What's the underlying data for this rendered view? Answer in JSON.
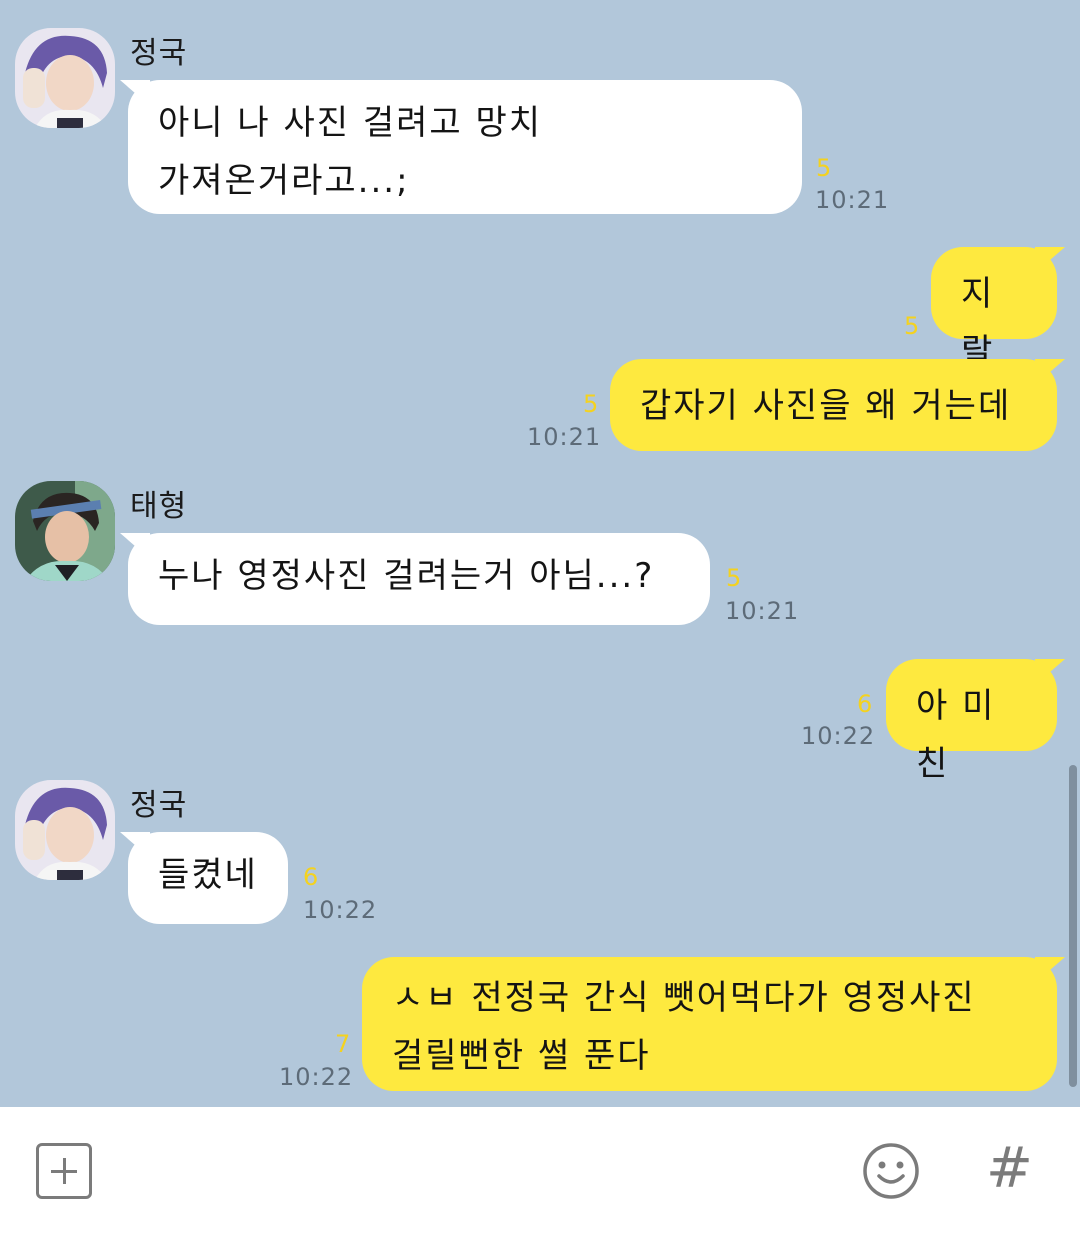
{
  "messages": [
    {
      "sender": "정국",
      "lines": [
        "아니 나 사진 걸려고 망치",
        "가져온거라고...;"
      ],
      "unread": "5",
      "time": "10:21",
      "direction": "in"
    },
    {
      "text": "지랄",
      "unread": "5",
      "direction": "out"
    },
    {
      "text": "갑자기 사진을 왜 거는데",
      "unread": "5",
      "time": "10:21",
      "direction": "out"
    },
    {
      "sender": "태형",
      "text": "누나 영정사진 걸려는거 아님...?",
      "unread": "5",
      "time": "10:21",
      "direction": "in"
    },
    {
      "text": "아 미친",
      "unread": "6",
      "time": "10:22",
      "direction": "out"
    },
    {
      "sender": "정국",
      "text": "들켰네",
      "unread": "6",
      "time": "10:22",
      "direction": "in"
    },
    {
      "lines": [
        "ㅅㅂ 전정국 간식 뺏어먹다가 영정사진",
        "걸릴뻔한 썰 푼다"
      ],
      "unread": "7",
      "time": "10:22",
      "direction": "out"
    }
  ],
  "input_bar": {
    "placeholder": "",
    "attach_icon": "plus-square-icon",
    "emoji_icon": "smiley-icon",
    "hashtag_icon": "#"
  },
  "colors": {
    "background": "#b2c7da",
    "incoming_bubble": "#ffffff",
    "outgoing_bubble": "#fee93f",
    "unread_count": "#f4d21f",
    "timestamp": "#5d6b78"
  }
}
